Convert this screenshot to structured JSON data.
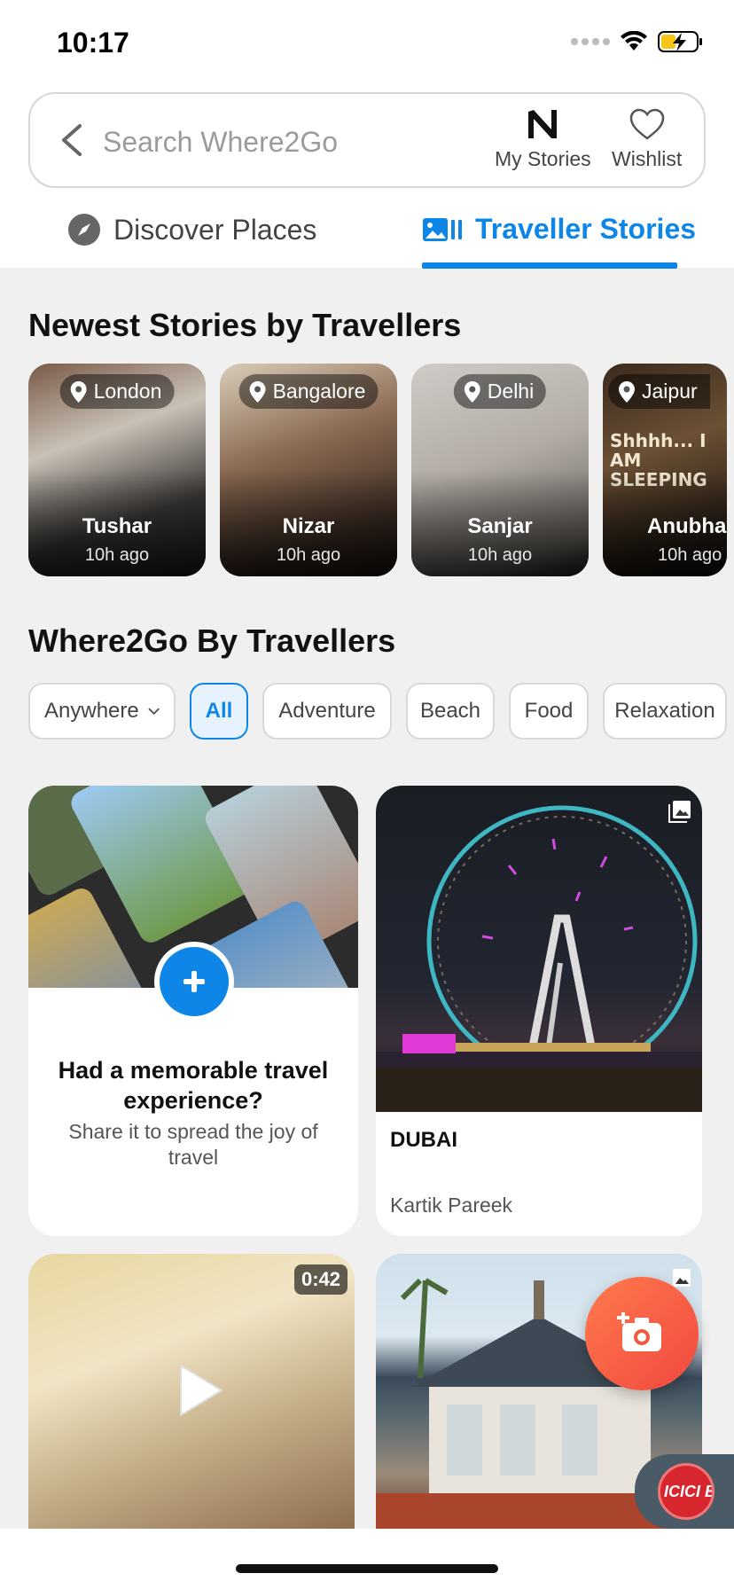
{
  "status_bar": {
    "time": "10:17"
  },
  "search": {
    "placeholder": "Search Where2Go"
  },
  "header": {
    "my_stories_label": "My Stories",
    "my_stories_logo": "N",
    "wishlist_label": "Wishlist"
  },
  "tabs": [
    {
      "label": "Discover Places",
      "active": false
    },
    {
      "label": "Traveller Stories",
      "active": true
    }
  ],
  "newest_section": {
    "title": "Newest Stories by Travellers",
    "stories": [
      {
        "location": "London",
        "name": "Tushar",
        "time": "10h ago"
      },
      {
        "location": "Bangalore",
        "name": "Nizar",
        "time": "10h ago"
      },
      {
        "location": "Delhi",
        "name": "Sanjar",
        "time": "10h ago"
      },
      {
        "location": "Jaipur",
        "name": "Anubhav",
        "time": "10h ago",
        "image_text": "Shhhh... I AM SLEEPING"
      }
    ]
  },
  "feed_section": {
    "title": "Where2Go By Travellers",
    "location_filter": "Anywhere",
    "categories": [
      "All",
      "Adventure",
      "Beach",
      "Food",
      "Relaxation"
    ],
    "selected_category": "All"
  },
  "share_card": {
    "title": "Had a memorable travel experience?",
    "subtitle": "Share it to spread the joy of travel"
  },
  "posts": [
    {
      "title": "DUBAI",
      "author": "Kartik Pareek",
      "media": "gallery"
    },
    {
      "media": "video",
      "duration": "0:42"
    },
    {
      "media": "gallery"
    }
  ],
  "ad": {
    "brand_text": "ICICI Ba"
  },
  "colors": {
    "accent": "#0d86e8",
    "fab": "#f25a3f"
  }
}
